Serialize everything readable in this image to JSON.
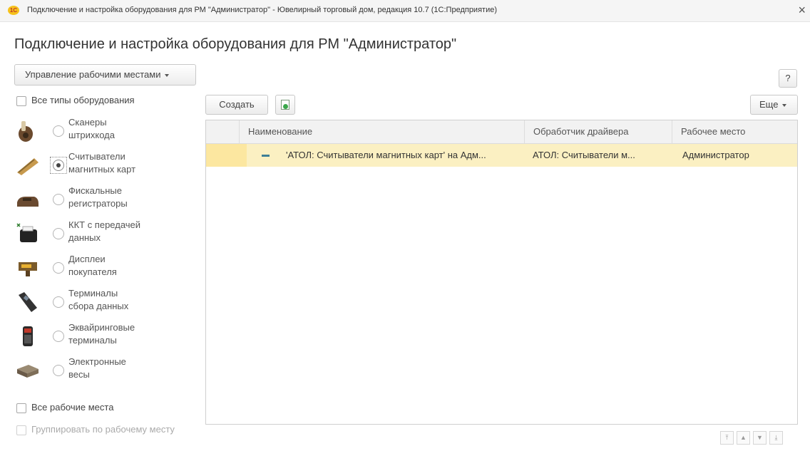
{
  "window": {
    "logo_text": "1С",
    "title": "Подключение и настройка оборудования для РМ \"Администратор\" - Ювелирный торговый дом, редакция 10.7  (1С:Предприятие)",
    "close_glyph": "×"
  },
  "page": {
    "title": "Подключение и настройка оборудования для РМ \"Администратор\""
  },
  "toolbar": {
    "manage_label": "Управление рабочими местами",
    "help_label": "?",
    "create_label": "Создать",
    "more_label": "Еще"
  },
  "filters": {
    "all_types_label": "Все типы оборудования",
    "all_types_checked": false,
    "all_workplaces_label": "Все рабочие места",
    "all_workplaces_checked": false,
    "group_by_label": "Группировать по рабочему месту",
    "group_by_enabled": false
  },
  "equipment_types": [
    {
      "line1": "Сканеры",
      "line2": "штрихкода",
      "icon": "barcode-scanner-icon",
      "selected": false
    },
    {
      "line1": "Считыватели",
      "line2": "магнитных карт",
      "icon": "card-reader-icon",
      "selected": true
    },
    {
      "line1": "Фискальные",
      "line2": "регистраторы",
      "icon": "fiscal-register-icon",
      "selected": false
    },
    {
      "line1": "ККТ с передачей",
      "line2": "данных",
      "icon": "cash-register-icon",
      "selected": false
    },
    {
      "line1": "Дисплеи",
      "line2": "покупателя",
      "icon": "customer-display-icon",
      "selected": false
    },
    {
      "line1": "Терминалы",
      "line2": "сбора данных",
      "icon": "data-terminal-icon",
      "selected": false
    },
    {
      "line1": "Эквайринговые",
      "line2": "терминалы",
      "icon": "acquiring-terminal-icon",
      "selected": false
    },
    {
      "line1": "Электронные",
      "line2": "весы",
      "icon": "scales-icon",
      "selected": false
    }
  ],
  "table": {
    "columns": [
      "Наименование",
      "Обработчик драйвера",
      "Рабочее место"
    ],
    "rows": [
      {
        "name": "'АТОЛ: Считыватели магнитных карт' на Адм...",
        "driver": "АТОЛ: Считыватели м...",
        "workplace": "Администратор",
        "selected": true
      }
    ]
  },
  "navigation": {
    "glyphs": [
      "⤒",
      "▲",
      "▼",
      "⤓"
    ]
  },
  "colors": {
    "selected_row": "#fbf0c2",
    "accent": "#f6c21b"
  }
}
